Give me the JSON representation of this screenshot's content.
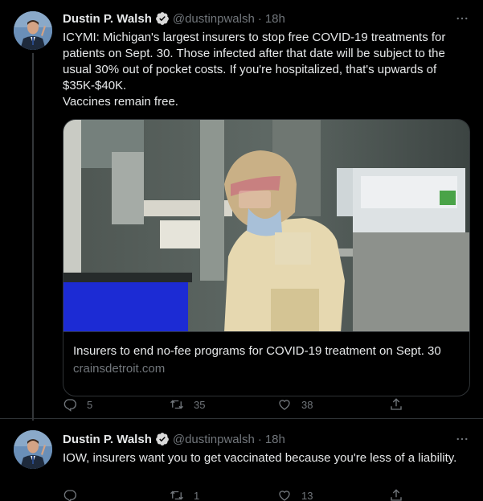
{
  "tweets": [
    {
      "author": {
        "name": "Dustin P. Walsh",
        "handle": "@dustinpwalsh"
      },
      "separator": "·",
      "time": "18h",
      "text": "ICYMI: Michigan's largest insurers to stop free COVID-19 treatments for patients on Sept. 30. Those infected after that date will be subject to the usual 30% out of pocket costs. If you're hospitalized, that's upwards of $35K-$40K.\nVaccines remain free.",
      "card": {
        "title": "Insurers to end no-fee programs for COVID-19 treatment on Sept. 30",
        "domain": "crainsdetroit.com"
      },
      "actions": {
        "replies": "5",
        "retweets": "35",
        "likes": "38"
      }
    },
    {
      "author": {
        "name": "Dustin P. Walsh",
        "handle": "@dustinpwalsh"
      },
      "separator": "·",
      "time": "18h",
      "text": "IOW, insurers want you to get vaccinated because you're less of a liability.",
      "actions": {
        "replies": "",
        "retweets": "1",
        "likes": "13"
      }
    }
  ],
  "colors": {
    "background": "#000000",
    "primary_text": "#e7e9ea",
    "secondary_text": "#71767b",
    "border": "#2f3336",
    "verified_badge": "#d9d9d9"
  },
  "icons": [
    "more-icon",
    "verified-icon",
    "reply-icon",
    "retweet-icon",
    "like-icon",
    "share-icon"
  ]
}
